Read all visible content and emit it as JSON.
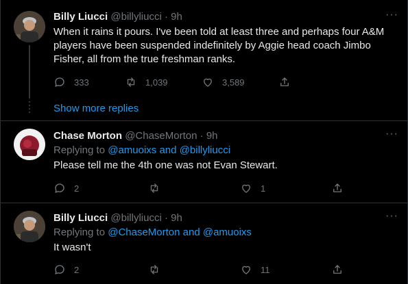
{
  "tweets": [
    {
      "name": "Billy Liucci",
      "handle": "@billyliucci",
      "dot": "·",
      "time": "9h",
      "text": "When it rains it pours.  I've been told at least three and perhaps four A&M players have been suspended indefinitely by Aggie head coach Jimbo Fisher, all from the true freshman ranks.",
      "replies": "333",
      "retweets": "1,039",
      "likes": "3,589"
    },
    {
      "name": "Chase Morton",
      "handle": "@ChaseMorton",
      "dot": "·",
      "time": "9h",
      "replying_prefix": "Replying to ",
      "replying_targets": "@amuoixs and @billyliucci",
      "text": "Please tell me the 4th one was not Evan Stewart.",
      "replies": "2",
      "retweets": "",
      "likes": "1"
    },
    {
      "name": "Billy Liucci",
      "handle": "@billyliucci",
      "dot": "·",
      "time": "9h",
      "replying_prefix": "Replying to ",
      "replying_targets": "@ChaseMorton and @amuoixs",
      "text": "It wasn't",
      "replies": "2",
      "retweets": "",
      "likes": "11"
    }
  ],
  "show_more_replies": "Show more replies",
  "more_glyph": "···",
  "colors": {
    "accent": "#1d9bf0",
    "muted": "#71767b",
    "text": "#e7e9ea",
    "background": "#000000"
  }
}
